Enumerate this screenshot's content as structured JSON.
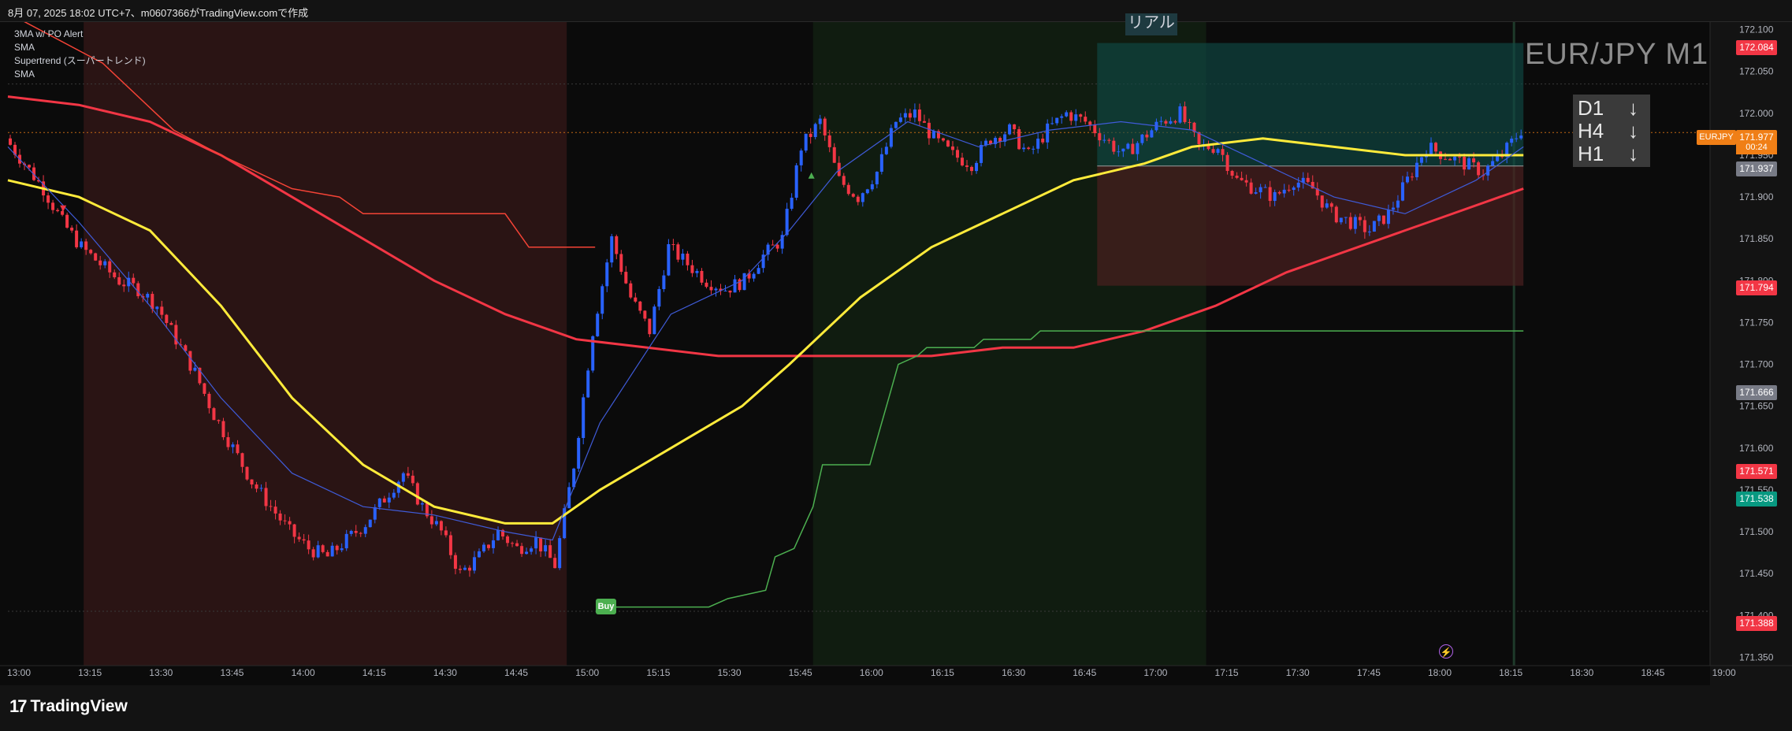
{
  "snapshot_text": "8月 07, 2025 18:02 UTC+7、m0607366がTradingView.comで作成",
  "legend": [
    "3MA w/ PO Alert",
    "SMA",
    "Supertrend (スーパートレンド)",
    "SMA"
  ],
  "symbol_title": "EUR/JPY M1",
  "timeframe_box": [
    {
      "tf": "D1",
      "direction": "↓"
    },
    {
      "tf": "H4",
      "direction": "↓"
    },
    {
      "tf": "H1",
      "direction": "↓"
    }
  ],
  "position_label": "リアル",
  "buy_label": "Buy",
  "brand": {
    "mark": "17",
    "name": "TradingView"
  },
  "bolt_icon": "⚡",
  "colors": {
    "background": "#0b0b0b",
    "candle_up": "#2962ff",
    "candle_down": "#f23645",
    "sma_red": "#f23645",
    "sma_yellow": "#ffeb3b",
    "ema_blue": "#3f5bd8",
    "supertrend_down": "#f44336",
    "supertrend_up": "#4caf50",
    "profit_zone": "#0f4a45",
    "loss_zone": "#4a2020"
  },
  "current_price": {
    "symbol": "EURJPY",
    "price": "171.977",
    "countdown": "00:24"
  },
  "price_tags": [
    {
      "price": "172.084",
      "color": "#f23645"
    },
    {
      "price": "171.937",
      "color": "#787b86"
    },
    {
      "price": "171.794",
      "color": "#f23645"
    },
    {
      "price": "171.666",
      "color": "#787b86"
    },
    {
      "price": "171.571",
      "color": "#f23645"
    },
    {
      "price": "171.538",
      "color": "#089981"
    },
    {
      "price": "171.388",
      "color": "#f23645"
    }
  ],
  "chart_data": {
    "type": "candlestick",
    "title": "EUR/JPY M1",
    "x_ticks": [
      "13:00",
      "13:15",
      "13:30",
      "13:45",
      "14:00",
      "14:15",
      "14:30",
      "14:45",
      "15:00",
      "15:15",
      "15:30",
      "15:45",
      "16:00",
      "16:15",
      "16:30",
      "16:45",
      "17:00",
      "17:15",
      "17:30",
      "17:45",
      "18:00",
      "18:15",
      "18:30",
      "18:45",
      "19:00"
    ],
    "y_ticks": [
      "172.100",
      "172.050",
      "172.000",
      "171.950",
      "171.900",
      "171.850",
      "171.800",
      "171.750",
      "171.700",
      "171.650",
      "171.600",
      "171.550",
      "171.500",
      "171.450",
      "171.400",
      "171.350"
    ],
    "ylim": [
      171.34,
      172.11
    ],
    "x_range_minutes": [
      0,
      360
    ],
    "close_series": {
      "name": "EURJPY",
      "points": [
        [
          0,
          171.97
        ],
        [
          4,
          171.94
        ],
        [
          8,
          171.91
        ],
        [
          12,
          171.87
        ],
        [
          16,
          171.84
        ],
        [
          20,
          171.82
        ],
        [
          24,
          171.8
        ],
        [
          28,
          171.79
        ],
        [
          32,
          171.77
        ],
        [
          36,
          171.73
        ],
        [
          40,
          171.69
        ],
        [
          44,
          171.64
        ],
        [
          48,
          171.6
        ],
        [
          52,
          171.56
        ],
        [
          56,
          171.53
        ],
        [
          60,
          171.5
        ],
        [
          64,
          171.48
        ],
        [
          68,
          171.47
        ],
        [
          72,
          171.49
        ],
        [
          76,
          171.51
        ],
        [
          80,
          171.54
        ],
        [
          84,
          171.57
        ],
        [
          88,
          171.53
        ],
        [
          92,
          171.5
        ],
        [
          96,
          171.45
        ],
        [
          100,
          171.47
        ],
        [
          104,
          171.5
        ],
        [
          108,
          171.48
        ],
        [
          112,
          171.49
        ],
        [
          116,
          171.46
        ],
        [
          120,
          171.58
        ],
        [
          124,
          171.74
        ],
        [
          128,
          171.85
        ],
        [
          132,
          171.78
        ],
        [
          136,
          171.74
        ],
        [
          140,
          171.84
        ],
        [
          144,
          171.82
        ],
        [
          148,
          171.8
        ],
        [
          152,
          171.79
        ],
        [
          156,
          171.8
        ],
        [
          160,
          171.83
        ],
        [
          164,
          171.85
        ],
        [
          168,
          171.96
        ],
        [
          172,
          171.99
        ],
        [
          176,
          171.92
        ],
        [
          180,
          171.9
        ],
        [
          184,
          171.93
        ],
        [
          188,
          171.99
        ],
        [
          192,
          172.0
        ],
        [
          196,
          171.97
        ],
        [
          200,
          171.95
        ],
        [
          204,
          171.94
        ],
        [
          208,
          171.97
        ],
        [
          212,
          171.98
        ],
        [
          216,
          171.95
        ],
        [
          220,
          171.98
        ],
        [
          224,
          172.0
        ],
        [
          228,
          171.99
        ],
        [
          232,
          171.97
        ],
        [
          236,
          171.95
        ],
        [
          240,
          171.97
        ],
        [
          244,
          171.99
        ],
        [
          248,
          172.0
        ],
        [
          252,
          171.96
        ],
        [
          256,
          171.96
        ],
        [
          260,
          171.92
        ],
        [
          264,
          171.91
        ],
        [
          268,
          171.9
        ],
        [
          272,
          171.92
        ],
        [
          276,
          171.91
        ],
        [
          280,
          171.88
        ],
        [
          284,
          171.87
        ],
        [
          288,
          171.86
        ],
        [
          292,
          171.88
        ],
        [
          296,
          171.92
        ],
        [
          300,
          171.96
        ],
        [
          304,
          171.95
        ],
        [
          308,
          171.94
        ],
        [
          312,
          171.93
        ],
        [
          316,
          171.95
        ],
        [
          320,
          171.98
        ]
      ]
    },
    "series": [
      {
        "name": "SMA",
        "color": "#f23645",
        "points": [
          [
            0,
            172.02
          ],
          [
            15,
            172.01
          ],
          [
            30,
            171.99
          ],
          [
            45,
            171.95
          ],
          [
            60,
            171.9
          ],
          [
            75,
            171.85
          ],
          [
            90,
            171.8
          ],
          [
            105,
            171.76
          ],
          [
            120,
            171.73
          ],
          [
            135,
            171.72
          ],
          [
            150,
            171.71
          ],
          [
            165,
            171.71
          ],
          [
            180,
            171.71
          ],
          [
            195,
            171.71
          ],
          [
            210,
            171.72
          ],
          [
            225,
            171.72
          ],
          [
            240,
            171.74
          ],
          [
            255,
            171.77
          ],
          [
            270,
            171.81
          ],
          [
            285,
            171.84
          ],
          [
            300,
            171.87
          ],
          [
            315,
            171.9
          ],
          [
            320,
            171.91
          ]
        ]
      },
      {
        "name": "SMA",
        "color": "#ffeb3b",
        "points": [
          [
            0,
            171.92
          ],
          [
            15,
            171.9
          ],
          [
            30,
            171.86
          ],
          [
            45,
            171.77
          ],
          [
            60,
            171.66
          ],
          [
            75,
            171.58
          ],
          [
            90,
            171.53
          ],
          [
            105,
            171.51
          ],
          [
            115,
            171.51
          ],
          [
            125,
            171.55
          ],
          [
            140,
            171.6
          ],
          [
            155,
            171.65
          ],
          [
            165,
            171.7
          ],
          [
            180,
            171.78
          ],
          [
            195,
            171.84
          ],
          [
            210,
            171.88
          ],
          [
            225,
            171.92
          ],
          [
            240,
            171.94
          ],
          [
            250,
            171.96
          ],
          [
            265,
            171.97
          ],
          [
            280,
            171.96
          ],
          [
            295,
            171.95
          ],
          [
            310,
            171.95
          ],
          [
            320,
            171.95
          ]
        ]
      },
      {
        "name": "3MA w/ PO Alert",
        "color": "#3f5bd8",
        "points": [
          [
            0,
            171.96
          ],
          [
            15,
            171.87
          ],
          [
            30,
            171.77
          ],
          [
            45,
            171.66
          ],
          [
            60,
            171.57
          ],
          [
            75,
            171.53
          ],
          [
            90,
            171.52
          ],
          [
            105,
            171.5
          ],
          [
            115,
            171.49
          ],
          [
            125,
            171.63
          ],
          [
            140,
            171.76
          ],
          [
            155,
            171.8
          ],
          [
            165,
            171.86
          ],
          [
            175,
            171.93
          ],
          [
            190,
            171.99
          ],
          [
            205,
            171.96
          ],
          [
            220,
            171.98
          ],
          [
            235,
            171.99
          ],
          [
            250,
            171.98
          ],
          [
            265,
            171.94
          ],
          [
            280,
            171.9
          ],
          [
            295,
            171.88
          ],
          [
            310,
            171.92
          ],
          [
            320,
            171.96
          ]
        ]
      }
    ],
    "supertrend": {
      "down": [
        [
          0,
          172.12
        ],
        [
          20,
          172.06
        ],
        [
          35,
          171.98
        ],
        [
          45,
          171.95
        ],
        [
          60,
          171.91
        ],
        [
          70,
          171.9
        ],
        [
          75,
          171.88
        ],
        [
          105,
          171.88
        ],
        [
          110,
          171.84
        ],
        [
          124,
          171.84
        ]
      ],
      "up": [
        [
          126,
          171.41
        ],
        [
          148,
          171.41
        ],
        [
          152,
          171.42
        ],
        [
          160,
          171.43
        ],
        [
          162,
          171.47
        ],
        [
          166,
          171.48
        ],
        [
          170,
          171.53
        ],
        [
          172,
          171.58
        ],
        [
          182,
          171.58
        ],
        [
          184,
          171.62
        ],
        [
          186,
          171.66
        ],
        [
          188,
          171.7
        ],
        [
          192,
          171.71
        ],
        [
          194,
          171.72
        ],
        [
          204,
          171.72
        ],
        [
          206,
          171.73
        ],
        [
          216,
          171.73
        ],
        [
          218,
          171.74
        ],
        [
          320,
          171.74
        ]
      ]
    },
    "position": {
      "label": "リアル",
      "entry": 171.937,
      "target": 172.084,
      "stop": 171.794,
      "start_min": 230,
      "end_min": 320
    },
    "vertical_zones": [
      {
        "start_min": 16,
        "end_min": 118,
        "kind": "sell"
      },
      {
        "start_min": 170,
        "end_min": 253,
        "kind": "buy"
      }
    ]
  }
}
